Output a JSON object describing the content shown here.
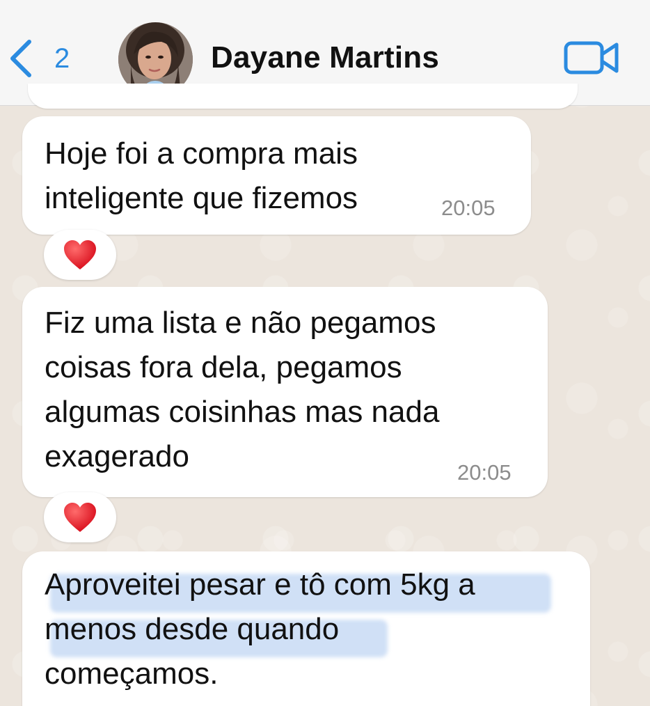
{
  "header": {
    "back_count": "2",
    "contact_name": "Dayane Martins"
  },
  "messages": [
    {
      "text": "Hoje foi a compra mais\ninteligente que fizemos",
      "time": "20:05",
      "reaction": "heart"
    },
    {
      "text": "Fiz uma lista e não pegamos\ncoisas fora dela, pegamos\nalgumas coisinhas mas nada\nexagerado",
      "time": "20:05",
      "reaction": "heart"
    },
    {
      "text": "Aproveitei pesar e tô com 5kg a\nmenos desde quando\ncomeçamos.",
      "highlighted": true
    }
  ],
  "colors": {
    "accent": "#2b8be0",
    "chat_background": "#ece5dd",
    "bubble": "#ffffff",
    "highlight": "#a8c4ee",
    "reaction_heart": "#e0202e"
  },
  "icons": {
    "back": "chevron-left-icon",
    "video_call": "video-camera-icon",
    "reaction": "red-heart-icon"
  }
}
